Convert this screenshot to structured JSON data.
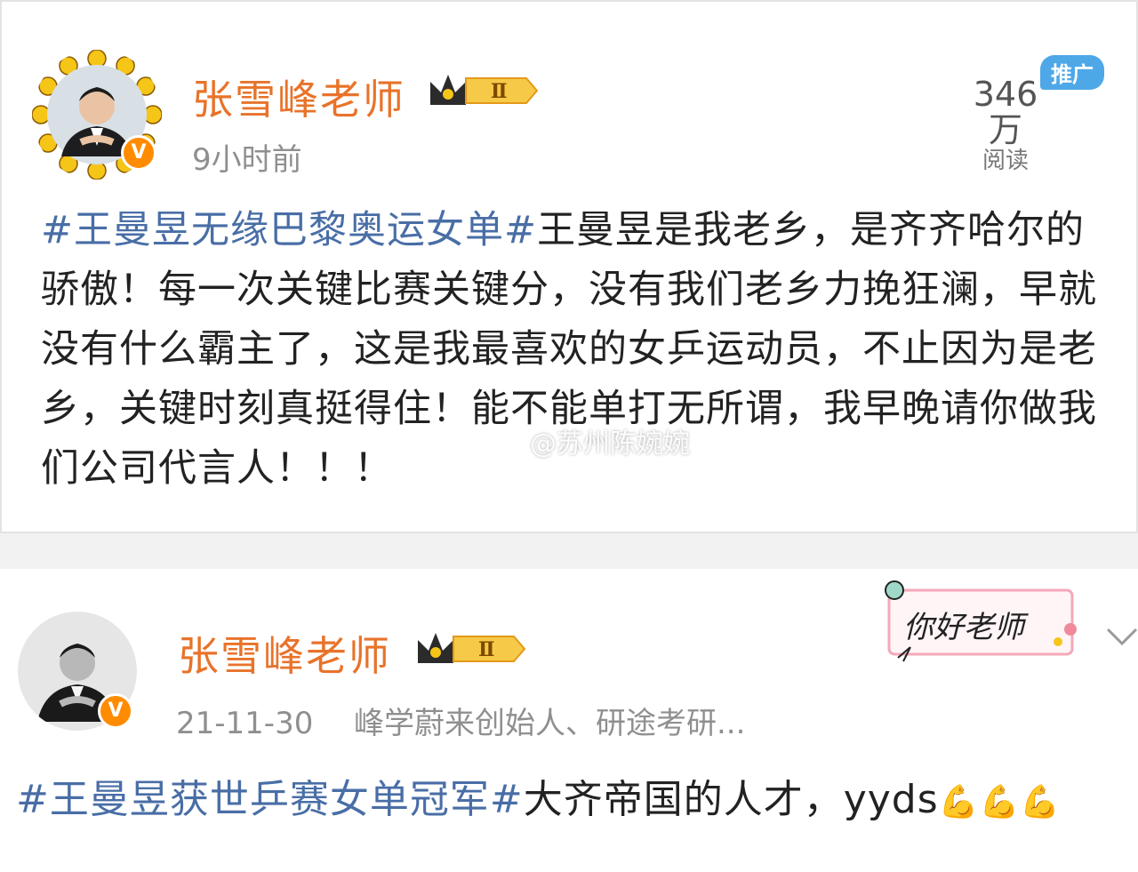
{
  "post1": {
    "author": "张雪峰老师",
    "level_badge": "Ⅱ",
    "verified_mark": "V",
    "time": "9小时前",
    "reads_count": "346万",
    "reads_label": "阅读",
    "promo_tag": "推广",
    "hashtag": "#王曼昱无缘巴黎奥运女单#",
    "text": "王曼昱是我老乡，是齐齐哈尔的骄傲！每一次关键比赛关键分，没有我们老乡力挽狂澜，早就没有什么霸主了，这是我最喜欢的女乒运动员，不止因为是老乡，关键时刻真挺得住！能不能单打无所谓，我早晚请你做我们公司代言人！！！",
    "watermark": "@苏州陈婉婉"
  },
  "post2": {
    "author": "张雪峰老师",
    "level_badge": "Ⅱ",
    "verified_mark": "V",
    "time": "21-11-30",
    "bio": "峰学蔚来创始人、研途考研...",
    "sticker": "你好老师",
    "hashtag": "#王曼昱获世乒赛女单冠军#",
    "text": "大齐帝国的人才，yyds",
    "emoji": "💪💪💪"
  },
  "icons": {
    "crown": "crown-icon",
    "chevron": "chevron-down-icon",
    "weibo": "weibo-logo-icon"
  },
  "colors": {
    "author_name": "#e8732a",
    "hashtag": "#496ea6",
    "verified": "#ff8c00",
    "promo": "#4ea8e8"
  }
}
